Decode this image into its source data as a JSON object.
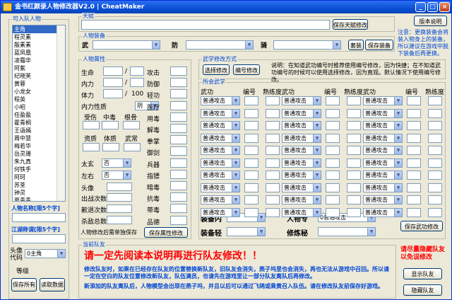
{
  "window": {
    "title": "金书红颜录人物修改器V2.0 | CheatMaker"
  },
  "characters": {
    "label": "可入队人物",
    "items": [
      "主角",
      "程灵素",
      "殷素素",
      "蓝凤凰",
      "凌霜华",
      "阿紫",
      "纪晓芙",
      "黄蓉",
      "小龙女",
      "程英",
      "小昭",
      "任盈盈",
      "霍青桐",
      "王语嫣",
      "周中慧",
      "梅若华",
      "岳灵珊",
      "朱九真",
      "何铁手",
      "阿珂",
      "苏荃",
      "钟灵",
      "夏青青",
      "李秋水",
      "袁"
    ],
    "selected": 0
  },
  "nickname": {
    "label": "人物名称[限5个字]",
    "value": ""
  },
  "alias": {
    "label": "江湖称谓[限5个字]",
    "value": ""
  },
  "avatar": {
    "label": "头像代码",
    "value": "0主角"
  },
  "level": {
    "label": "等级"
  },
  "buttons": {
    "save_all": "保存所有",
    "read_data": "读取数据"
  },
  "talent": {
    "label": "天赋",
    "button": "保存天赋修改"
  },
  "equipment": {
    "label": "人物装备",
    "weapon": "武",
    "armor": "防",
    "mount": "骑",
    "suit": "套装",
    "save": "保存装备"
  },
  "attrs": {
    "label": "人物属性",
    "life": "生命",
    "inner": "内力",
    "stamina": "体力",
    "stamina_max": "100",
    "nature": "内力性质",
    "nature_val": "阴",
    "aptitude": "受伤",
    "poison": "中毒",
    "bones": "根骨",
    "qualification": "资质",
    "physique": "体质",
    "martial": "武常",
    "taiji": "太玄",
    "left_right": "左右",
    "no": "否",
    "avatar": "头像",
    "rounds": "出战次数",
    "loop": "歉退次数",
    "kills": "杀敌总数",
    "note": "人物修改后需单独保存",
    "save": "保存属性修改"
  },
  "stats": [
    "攻击",
    "防御",
    "轻功",
    "医疗",
    "用毒",
    "解毒",
    "拳掌",
    "御剑",
    "兵器",
    "指镖",
    "暗毒",
    "抗毒",
    "带毒",
    "品德"
  ],
  "method": {
    "label": "武学修改方式",
    "select": "选择修改",
    "code": "编号修改",
    "explain": "说明：在知道武功编号时推荐使用编号修改，因为快捷；在不知道武功编号的时候可以使用选择修改，因为直观。默认情况下使用编号修改。"
  },
  "skills": {
    "label": "所会武学",
    "col_skill": "武功",
    "col_code": "编号",
    "col_level": "熟练度",
    "default": "普通攻击"
  },
  "skill_extra": {
    "equip_inner": "装备内",
    "equip_light": "装备轻",
    "specialty": "人物专",
    "practice": "修炼秘",
    "specialty_val": "0普通攻击",
    "save": "保存武功修改"
  },
  "version_btn": "版本说明",
  "note_right": "注意：更换装备会将装入物身上的装备，所以建议在游戏中脱下装备后再更换。",
  "party": {
    "label": "当前队友",
    "warning": "请一定先阅读本说明再进行队友修改！！",
    "text1": "修改队友时，如果在已经存在队友的位置替换新队友，旧队友会消失，燕子坞里也会消失，再也无法从游戏中召回。所以请一定在空白的队友位置修改新队友，队伍满员，也请先在游戏里让一部分队友离队后再修改。",
    "text2": "新添加的队友离队后，人物模型会出现在燕子坞，并且以后可以通过飞鸽或乘黄召入队伍。请在修改队友前保存好游戏。",
    "hint": "请尽量隐藏队友以免误修改",
    "show": "显示队友",
    "hide": "隐藏队友"
  }
}
